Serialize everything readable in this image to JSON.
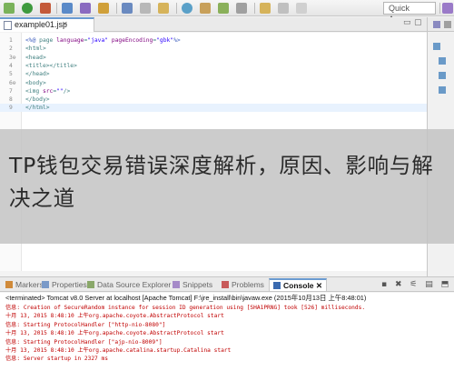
{
  "toolbar": {
    "quick_access_placeholder": "Quick Access",
    "icons": [
      "debug-icon",
      "run-icon",
      "external-tools-icon",
      "search-icon",
      "back-icon",
      "forward-icon"
    ]
  },
  "editor": {
    "tab": {
      "label": "example01.jsp",
      "close_glyph": "✕"
    },
    "pane_controls": [
      "▭",
      "▢"
    ],
    "lines": [
      {
        "num": "1",
        "parts": [
          [
            "dir",
            "<%@ "
          ],
          [
            "tag",
            "page "
          ],
          [
            "attr",
            "language"
          ],
          [
            "tag",
            "="
          ],
          [
            "str",
            "\"java\""
          ],
          [
            "tag",
            " "
          ],
          [
            "attr",
            "pageEncoding"
          ],
          [
            "tag",
            "="
          ],
          [
            "str",
            "\"gbk\""
          ],
          [
            "dir",
            "%>"
          ]
        ]
      },
      {
        "num": "2",
        "parts": [
          [
            "tag",
            "<html>"
          ]
        ]
      },
      {
        "num": "3⊖",
        "parts": [
          [
            "tag",
            "<head>"
          ]
        ]
      },
      {
        "num": "4",
        "parts": [
          [
            "tag",
            "<title></title>"
          ]
        ]
      },
      {
        "num": "5",
        "parts": [
          [
            "tag",
            "</head>"
          ]
        ]
      },
      {
        "num": "6⊖",
        "parts": [
          [
            "tag",
            "<body>"
          ]
        ]
      },
      {
        "num": "7",
        "parts": [
          [
            "tag",
            "<img "
          ],
          [
            "attr",
            "src"
          ],
          [
            "tag",
            "="
          ],
          [
            "str",
            "\"\""
          ],
          [
            "tag",
            "/>"
          ]
        ]
      },
      {
        "num": "8",
        "parts": [
          [
            "tag",
            "</body>"
          ]
        ]
      },
      {
        "num": "9",
        "parts": [
          [
            "tag",
            "</html>"
          ]
        ]
      }
    ]
  },
  "overlay": {
    "title": "TP钱包交易错误深度解析，原因、影响与解决之道"
  },
  "views": {
    "tabs": [
      {
        "label": "Markers",
        "icon": "markers-icon",
        "color": "#d08a3a"
      },
      {
        "label": "Properties",
        "icon": "properties-icon",
        "color": "#7a9ac8"
      },
      {
        "label": "Data Source Explorer",
        "icon": "data-source-icon",
        "color": "#8aa86a"
      },
      {
        "label": "Snippets",
        "icon": "snippets-icon",
        "color": "#a58ac8"
      },
      {
        "label": "Problems",
        "icon": "problems-icon",
        "color": "#c85a5a"
      },
      {
        "label": "Console ✕",
        "icon": "console-icon",
        "color": "#3a6ab0",
        "active": true
      }
    ],
    "tools": "▪ ✖ ⚟ ▤ ⬒"
  },
  "console": {
    "status": "<terminated> Tomcat v8.0 Server at localhost [Apache Tomcat] F:\\jre_install\\bin\\javaw.exe (2015年10月13日 上午8:48:01)",
    "lines": [
      "信息: Creation of SecureRandom instance for session ID generation using [SHA1PRNG] took [526] milliseconds.",
      "十月 13, 2015 8:48:10 上午org.apache.coyote.AbstractProtocol start",
      "信息: Starting ProtocolHandler [\"http-nio-8080\"]",
      "十月 13, 2015 8:48:10 上午org.apache.coyote.AbstractProtocol start",
      "信息: Starting ProtocolHandler [\"ajp-nio-8009\"]",
      "十月 13, 2015 8:48:10 上午org.apache.catalina.startup.Catalina start",
      "信息: Server startup in 2327 ms"
    ]
  }
}
